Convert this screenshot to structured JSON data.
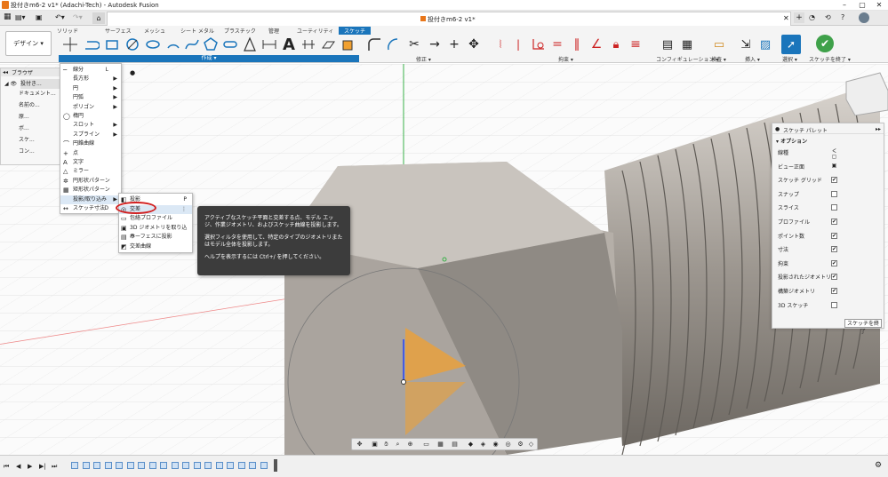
{
  "window": {
    "title": "投付きm6-2 v1* (Adachi-Tech) - Autodesk Fusion",
    "doc_tab": "投付きm6-2 v1*"
  },
  "ribbon": {
    "tabs": [
      "ソリッド",
      "サーフェス",
      "メッシュ",
      "シート メタル",
      "プラスチック",
      "管理",
      "ユーティリティ",
      "スケッチ"
    ],
    "active_tab": "スケッチ",
    "workspace": "デザイン ▾",
    "groups": {
      "create": "作成 ▾",
      "modify": "修正 ▾",
      "constraints": "拘束 ▾",
      "configure": "コンフィギュレーション ▾",
      "inspect": "検査 ▾",
      "insert": "挿入 ▾",
      "select": "選択 ▾",
      "finish": "スケッチを終了 ▾"
    }
  },
  "browser": {
    "title": "ブラウザ",
    "items": [
      "投付き...",
      "ドキュメント...",
      "名前の...",
      "原...",
      "ボ...",
      "スケ...",
      "コン..."
    ]
  },
  "create_menu": {
    "items": [
      {
        "label": "線分",
        "key": "L",
        "icon": "─"
      },
      {
        "label": "長方形",
        "arrow": "▶",
        "icon": ""
      },
      {
        "label": "円",
        "arrow": "▶",
        "icon": ""
      },
      {
        "label": "円弧",
        "arrow": "▶",
        "icon": ""
      },
      {
        "label": "ポリゴン",
        "arrow": "▶",
        "icon": ""
      },
      {
        "label": "楕円",
        "icon": "◯"
      },
      {
        "label": "スロット",
        "arrow": "▶",
        "icon": ""
      },
      {
        "label": "スプライン",
        "arrow": "▶",
        "icon": ""
      },
      {
        "label": "円錐曲線",
        "icon": "⌒"
      },
      {
        "label": "点",
        "icon": "+"
      },
      {
        "label": "文字",
        "icon": "A"
      },
      {
        "label": "ミラー",
        "icon": "△"
      },
      {
        "label": "円形状パターン",
        "icon": "✲"
      },
      {
        "label": "矩形状パターン",
        "icon": "▦"
      },
      {
        "label": "投影/取り込み",
        "arrow": "▶",
        "icon": ""
      },
      {
        "label": "スケッチ寸法",
        "key": "D",
        "icon": "↔"
      }
    ]
  },
  "project_submenu": {
    "items": [
      {
        "label": "投影",
        "key": "P",
        "icon": "◧"
      },
      {
        "label": "交差",
        "key": "⋮",
        "icon": "◎"
      },
      {
        "label": "包絡プロファイル",
        "icon": "▭"
      },
      {
        "label": "3D ジオメトリを取り込み",
        "icon": "▣"
      },
      {
        "label": "サーフェスに投影",
        "icon": "▤"
      },
      {
        "label": "交差曲線",
        "icon": "◩"
      }
    ]
  },
  "tooltip": {
    "p1": "アクティブなスケッチ平面と交差する点、モデル エッジ、作業ジオメトリ、およびスケッチ曲線を投影します。",
    "p2": "選択フィルタを使用して、特定のタイプのジオメトリまたはモデル全体を投影します。",
    "p3": "ヘルプを表示するには Ctrl+/ を押してください。"
  },
  "palette": {
    "title": "スケッチ パレット",
    "section": "▾ オプション",
    "rows": [
      {
        "label": "線種",
        "checked": null
      },
      {
        "label": "ビュー正面",
        "checked": null
      },
      {
        "label": "スケッチ グリッド",
        "checked": true
      },
      {
        "label": "スナップ",
        "checked": false
      },
      {
        "label": "スライス",
        "checked": false
      },
      {
        "label": "プロファイル",
        "checked": true
      },
      {
        "label": "ポイント数",
        "checked": true
      },
      {
        "label": "寸法",
        "checked": true
      },
      {
        "label": "拘束",
        "checked": true
      },
      {
        "label": "投影されたジオメトリ",
        "checked": true
      },
      {
        "label": "構築ジオメトリ",
        "checked": true
      },
      {
        "label": "3D スケッチ",
        "checked": false
      }
    ],
    "finish_label": "スケッチを終了"
  },
  "colors": {
    "accent": "#1a75bb",
    "bolt": "#a8a29a",
    "sketch_orange": "#f0a030",
    "highlight_red": "#d21f1f"
  }
}
